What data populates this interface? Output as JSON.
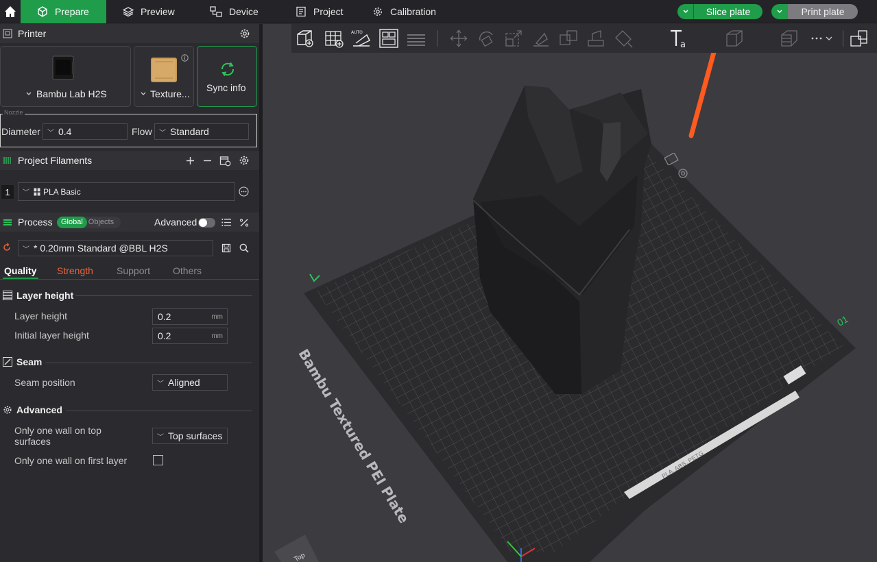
{
  "topbar": {
    "tabs": [
      {
        "label": "Prepare",
        "icon": "cube-icon",
        "active": true
      },
      {
        "label": "Preview",
        "icon": "layers-icon",
        "active": false
      },
      {
        "label": "Device",
        "icon": "device-icon",
        "active": false
      },
      {
        "label": "Project",
        "icon": "document-icon",
        "active": false
      },
      {
        "label": "Calibration",
        "icon": "gear-icon",
        "active": false
      }
    ],
    "slice_label": "Slice plate",
    "print_label": "Print plate",
    "accent": "#1f9d4a"
  },
  "printer": {
    "section_title": "Printer",
    "printer_name": "Bambu Lab H2S",
    "plate_name": "Texture...",
    "sync_label": "Sync info",
    "nozzle_legend": "Nozzle",
    "diameter_label": "Diameter",
    "diameter_value": "0.4",
    "flow_label": "Flow",
    "flow_value": "Standard"
  },
  "filaments": {
    "section_title": "Project Filaments",
    "items": [
      {
        "index": "1",
        "name": "PLA Basic"
      }
    ]
  },
  "process": {
    "section_title": "Process",
    "toggle_global": "Global",
    "toggle_objects": "Objects",
    "advanced_label": "Advanced",
    "preset": "* 0.20mm Standard @BBL H2S",
    "tabs": [
      "Quality",
      "Strength",
      "Support",
      "Others"
    ],
    "groups": {
      "layer_height": {
        "title": "Layer height",
        "layer_height_label": "Layer height",
        "layer_height_value": "0.2",
        "initial_layer_height_label": "Initial layer height",
        "initial_layer_height_value": "0.2",
        "unit": "mm"
      },
      "seam": {
        "title": "Seam",
        "seam_position_label": "Seam position",
        "seam_position_value": "Aligned"
      },
      "advanced": {
        "title": "Advanced",
        "one_wall_top_label_1": "Only one wall on top",
        "one_wall_top_label_2": "surfaces",
        "one_wall_top_value": "Top surfaces",
        "one_wall_first_label": "Only one wall on first layer"
      }
    }
  },
  "viewport": {
    "plate_text": "Bambu Textured PEI Plate",
    "plate_number": "01",
    "plate_strip_text": "PLA, ABS, PETG",
    "view_cube_label": "Top"
  }
}
